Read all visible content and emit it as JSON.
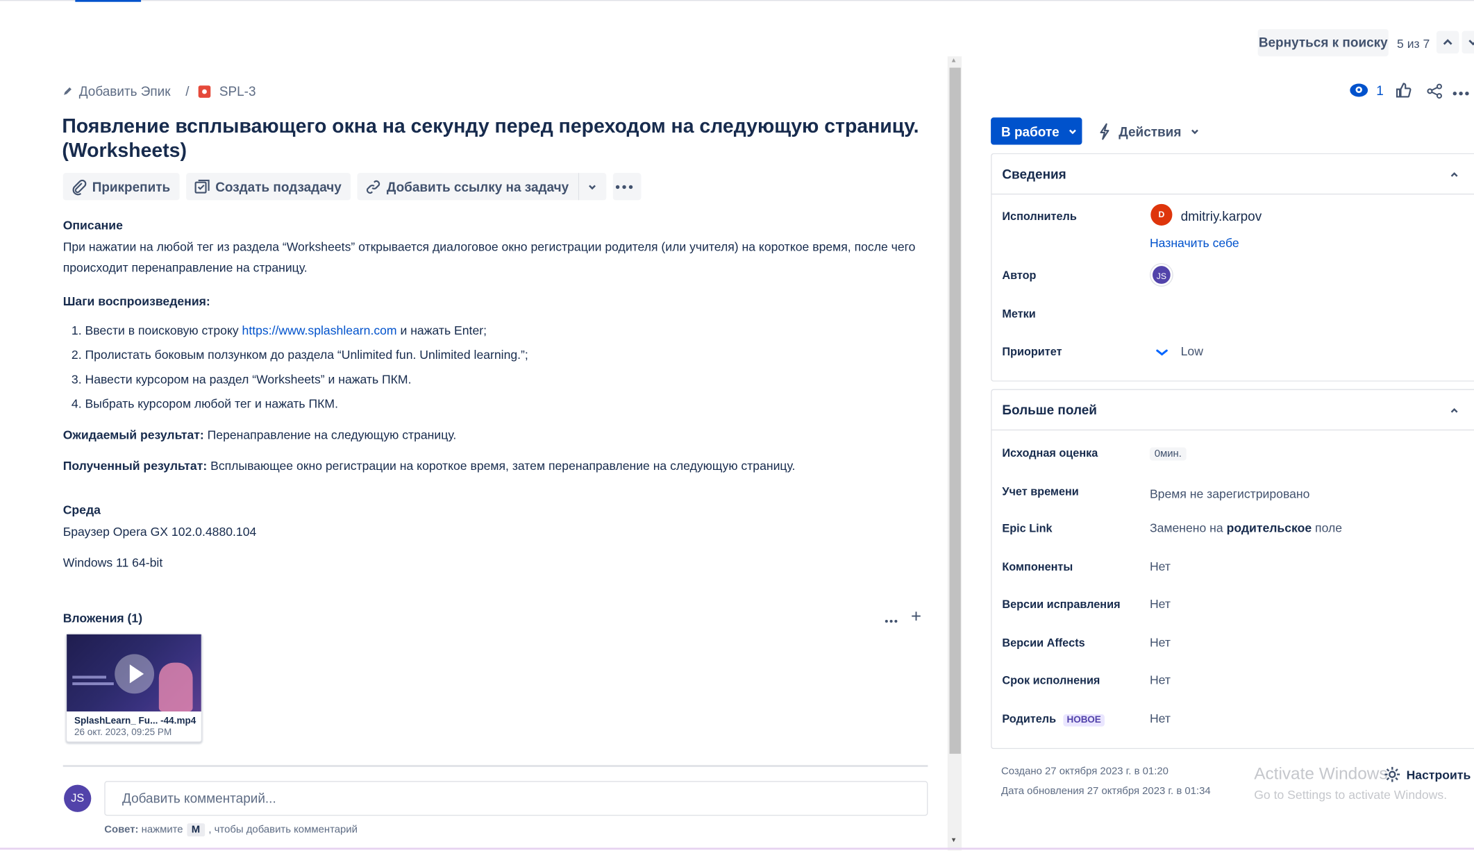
{
  "nav": {
    "back_label": "Вернуться к поиску",
    "pager": "5 из 7"
  },
  "breadcrumb": {
    "add_epic": "Добавить Эпик",
    "separator": "/",
    "issue_key": "SPL-3"
  },
  "issue": {
    "title": "Появление всплывающего окна на секунду перед переходом на следующую страницу. (Worksheets)"
  },
  "toolbar": {
    "attach": "Прикрепить",
    "create_subtask": "Создать подзадачу",
    "add_link": "Добавить ссылку на задачу"
  },
  "description": {
    "heading": "Описание",
    "text": "При нажатии на любой тег из раздела “Worksheets” открывается диалоговое окно регистрации родителя (или учителя) на короткое время, после чего происходит перенаправление на страницу.",
    "steps_heading": "Шаги воспроизведения:",
    "steps": [
      {
        "num": "1.",
        "before": "Ввести в поисковую строку ",
        "link": "https://www.splashlearn.com",
        "after": " и нажать Enter;"
      },
      {
        "num": "2.",
        "before": "Пролистать боковым ползунком до раздела “Unlimited fun. Unlimited learning.”;",
        "link": "",
        "after": ""
      },
      {
        "num": "3.",
        "before": "Навести курсором на раздел “Worksheets” и нажать ПКМ.",
        "link": "",
        "after": ""
      },
      {
        "num": "4.",
        "before": "Выбрать курсором любой тег и нажать ПКМ.",
        "link": "",
        "after": ""
      }
    ],
    "expected_label": "Ожидаемый результат:",
    "expected_text": " Перенаправление на следующую страницу.",
    "actual_label": "Полученный результат:",
    "actual_text": " Всплывающее окно регистрации на короткое время, затем перенаправление на следующую страницу."
  },
  "environment": {
    "heading": "Среда",
    "browser": "Браузер Opera GX 102.0.4880.104",
    "os": "Windows 11 64-bit"
  },
  "attachments": {
    "heading": "Вложения (1)",
    "add": "+",
    "file_name": "SplashLearn_ Fu... -44.mp4",
    "file_date": "26 окт. 2023, 09:25 PM"
  },
  "comment": {
    "avatar": "JS",
    "placeholder": "Добавить комментарий...",
    "tip_prefix": "Совет:",
    "tip_press": "нажмите",
    "tip_key": "M",
    "tip_suffix": ", чтобы добавить комментарий"
  },
  "header_actions": {
    "watch_count": "1"
  },
  "status": {
    "label": "В работе",
    "actions": "Действия",
    "color": "#0052cc"
  },
  "details": {
    "heading": "Сведения",
    "assignee_label": "Исполнитель",
    "assignee_initial": "D",
    "assignee_name": "dmitriy.karpov",
    "assign_self": "Назначить себе",
    "author_label": "Автор",
    "author_initials": "JS",
    "labels_label": "Метки",
    "priority_label": "Приоритет",
    "priority_value": "Low"
  },
  "more_fields": {
    "heading": "Больше полей",
    "rows": [
      {
        "label": "Исходная оценка",
        "value": "0мин."
      },
      {
        "label": "Учет времени",
        "value": "Время не зарегистрировано"
      },
      {
        "label": "Epic Link",
        "value_prefix": "Заменено на ",
        "value_bold": "родительское",
        "value_suffix": " поле"
      },
      {
        "label": "Компоненты",
        "value": "Нет"
      },
      {
        "label": "Версии исправления",
        "value": "Нет"
      },
      {
        "label": "Версии Affects",
        "value": "Нет"
      },
      {
        "label": "Срок исполнения",
        "value": "Нет"
      },
      {
        "label": "Родитель",
        "badge": "НОВОЕ",
        "value": "Нет"
      }
    ]
  },
  "footer": {
    "created": "Создано 27 октября 2023 г. в 01:20",
    "updated": "Дата обновления 27 октября 2023 г. в 01:34",
    "configure": "Настроить",
    "watermark_title": "Activate Windows",
    "watermark_sub": "Go to Settings to activate Windows."
  }
}
